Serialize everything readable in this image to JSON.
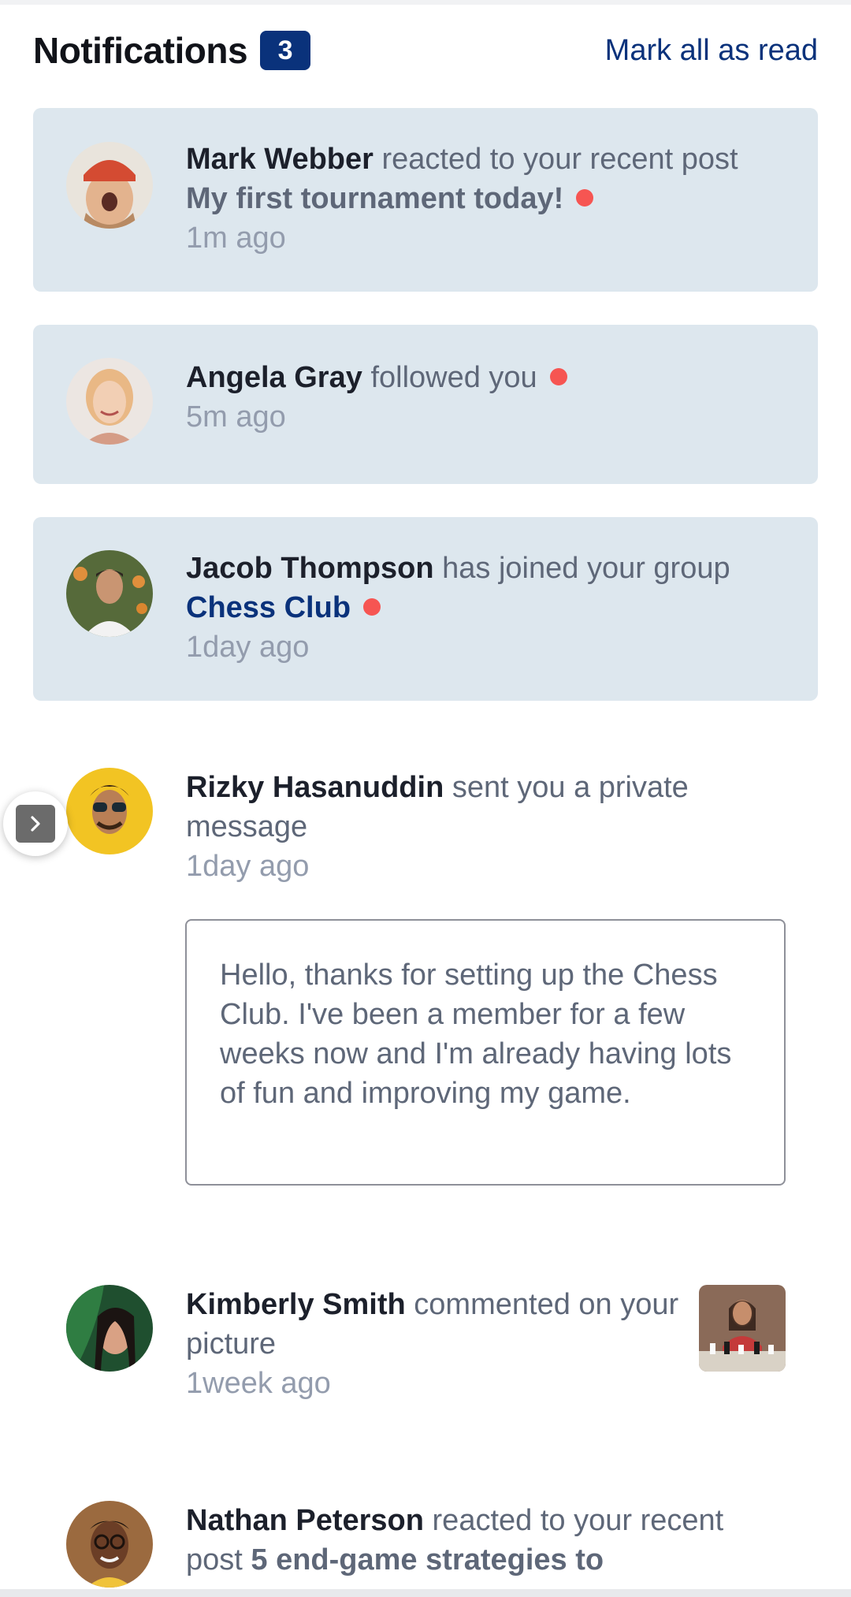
{
  "header": {
    "title": "Notifications",
    "unread_count": "3",
    "mark_all_label": "Mark all as read"
  },
  "notifications": [
    {
      "name": "Mark Webber",
      "action": "reacted to your recent post",
      "post": "My first tournament today!",
      "time": "1m ago",
      "unread": true,
      "avatar": "avatar-mark-webber"
    },
    {
      "name": "Angela Gray",
      "action": "followed you",
      "time": "5m ago",
      "unread": true,
      "avatar": "avatar-angela-gray"
    },
    {
      "name": "Jacob Thompson",
      "action": "has joined your group",
      "group": "Chess Club",
      "time": "1day ago",
      "unread": true,
      "avatar": "avatar-jacob-thompson"
    },
    {
      "name": "Rizky Hasanuddin",
      "action": "sent you a private message",
      "time": "1day ago",
      "unread": false,
      "message": "Hello, thanks for setting up the Chess Club. I've been a member for a few weeks now and I'm already having lots of fun and improving my game.",
      "avatar": "avatar-rizky-hasanuddin"
    },
    {
      "name": "Kimberly Smith",
      "action": "commented on your picture",
      "time": "1week ago",
      "unread": false,
      "avatar": "avatar-kimberly-smith",
      "picture": "chess-picture-thumbnail"
    },
    {
      "name": "Nathan Peterson",
      "action": "reacted to your recent post",
      "post": "5 end-game strategies to",
      "unread": false,
      "avatar": "avatar-nathan-peterson"
    }
  ],
  "colors": {
    "accent": "#0a327b",
    "unread_bg": "#dde7ee",
    "dot": "#f65552",
    "text_muted": "#5e6778",
    "time": "#939cad"
  },
  "icons": {
    "side_handle": "chevron-right-icon"
  }
}
